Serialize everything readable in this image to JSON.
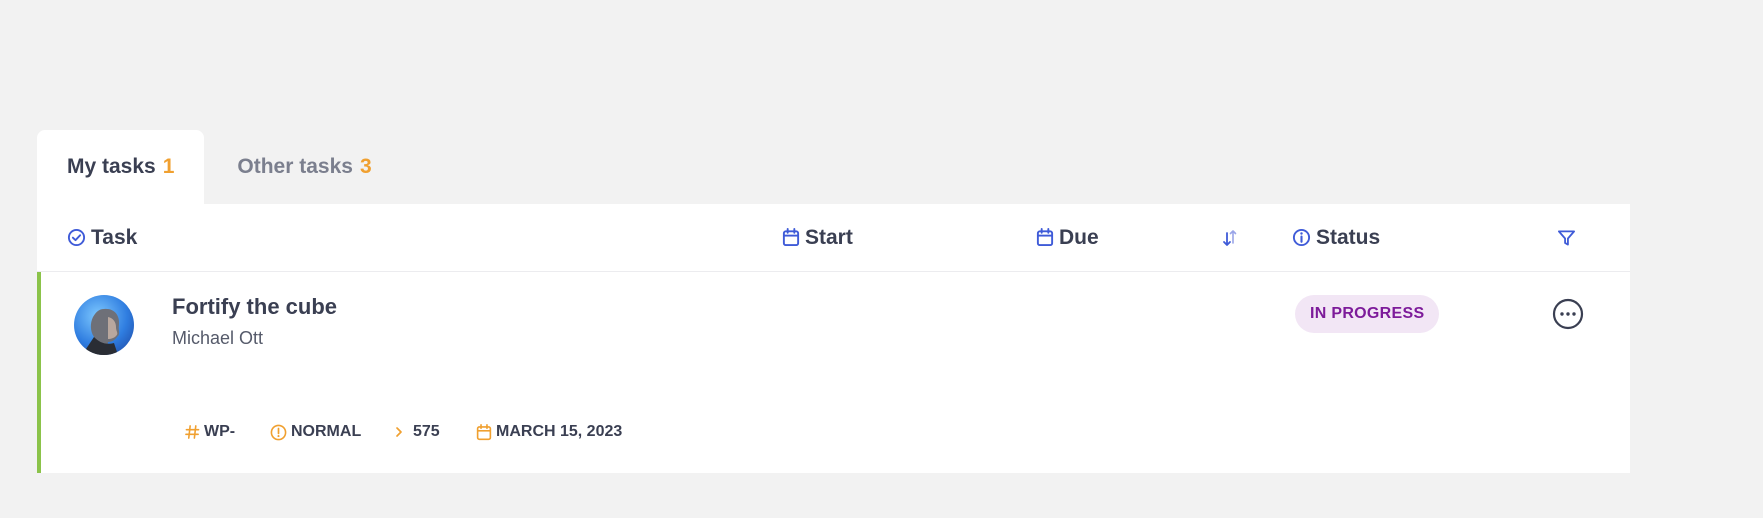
{
  "tabs": [
    {
      "label": "My tasks",
      "count": "1",
      "active": true
    },
    {
      "label": "Other tasks",
      "count": "3",
      "active": false
    }
  ],
  "columns": {
    "task": {
      "label": "Task",
      "icon": "check-circle-icon"
    },
    "start": {
      "label": "Start",
      "icon": "calendar-icon"
    },
    "due": {
      "label": "Due",
      "icon": "calendar-icon"
    },
    "sort": {
      "icon": "sort-arrows-icon"
    },
    "status": {
      "label": "Status",
      "icon": "info-icon"
    },
    "filter": {
      "icon": "filter-icon"
    }
  },
  "tasks": [
    {
      "title": "Fortify the cube",
      "assignee": "Michael Ott",
      "status": "IN PROGRESS",
      "code": "WP-",
      "priority": "NORMAL",
      "number": "575",
      "date": "MARCH 15, 2023",
      "accent_color": "#8bc34a"
    }
  ],
  "colors": {
    "accent_blue": "#3f5bd8",
    "accent_orange": "#f0a030",
    "status_purple": "#7d1b9a",
    "status_bg": "#f2e6f5",
    "row_accent_green": "#8bc34a"
  }
}
